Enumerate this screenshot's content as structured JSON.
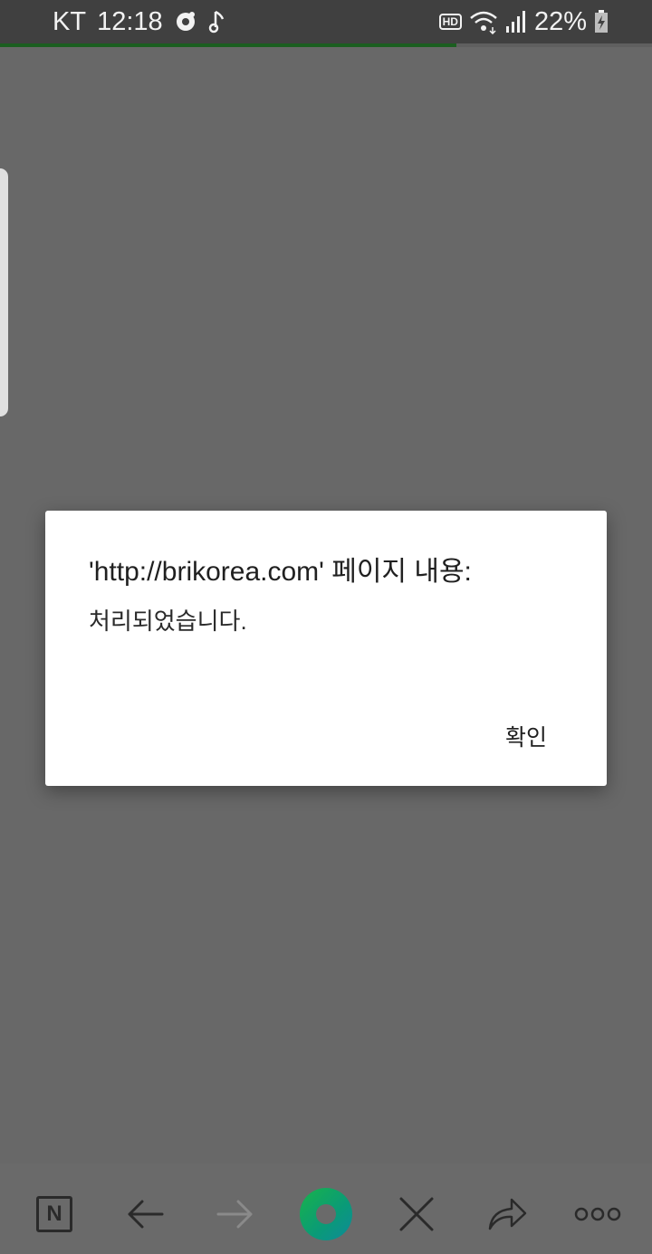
{
  "status_bar": {
    "carrier": "KT",
    "time": "12:18",
    "hd_label": "HD",
    "battery_percent": "22%",
    "icons": [
      "record-icon",
      "music-note-icon",
      "wifi-icon",
      "signal-icon",
      "battery-charging-icon"
    ]
  },
  "page_load_progress": 0.7,
  "dialog": {
    "title": "'http://brikorea.com' 페이지 내용:",
    "message": "처리되었습니다.",
    "ok_label": "확인"
  },
  "bottom_bar": {
    "logo_label": "N",
    "items": [
      "naver-home-icon",
      "back-arrow-icon",
      "forward-arrow-icon",
      "green-dot-icon",
      "close-icon",
      "share-icon",
      "more-icon"
    ]
  },
  "colors": {
    "overlay": "#686868",
    "status_bar": "#404040",
    "progress": "#1b5e20",
    "accent_green": "#18b34a"
  }
}
